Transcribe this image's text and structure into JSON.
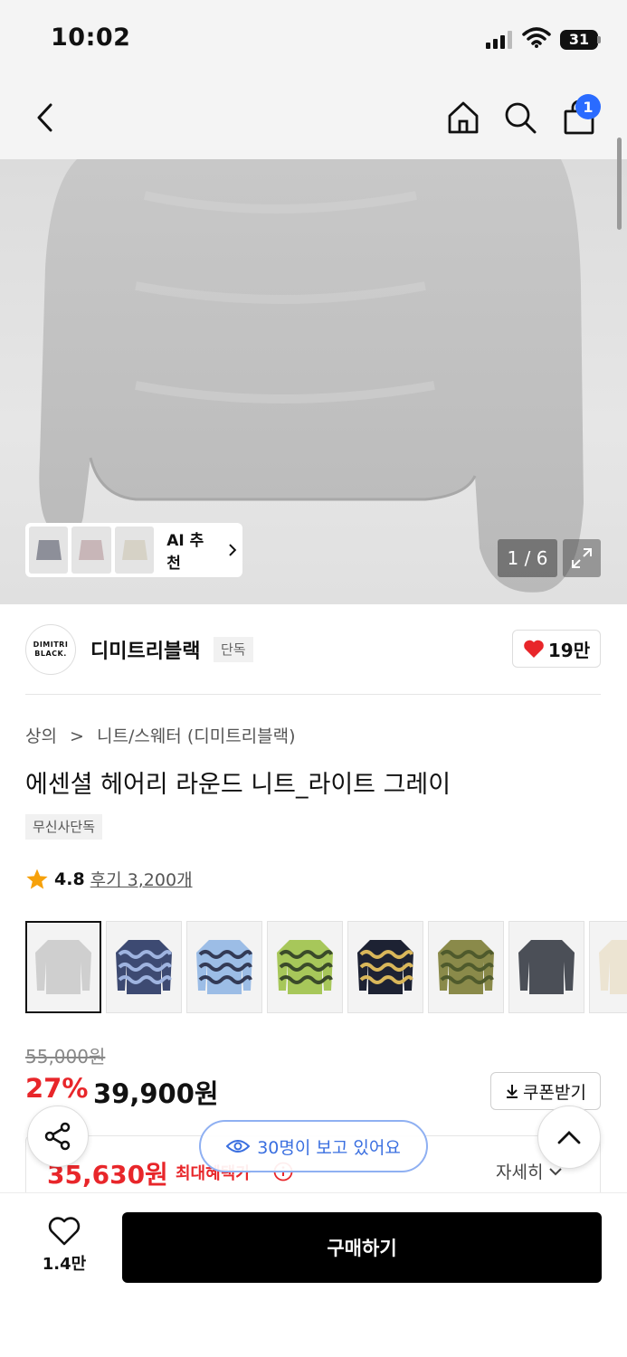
{
  "status": {
    "time": "10:02",
    "battery": "31"
  },
  "nav": {
    "back_icon": "chevron-left-icon",
    "home_icon": "home-icon",
    "search_icon": "search-icon",
    "cart_icon": "shopping-bag-icon",
    "cart_count": "1"
  },
  "gallery": {
    "ai_label": "AI 추천",
    "pager": "1 / 6",
    "expand_icon": "expand-icon"
  },
  "brand": {
    "logo_line1": "DIMITRI",
    "logo_line2": "BLACK.",
    "name": "디미트리블랙",
    "tag": "단독",
    "likes": "19만"
  },
  "product": {
    "breadcrumb_category": "상의",
    "breadcrumb_sub": "니트/스웨터 (디미트리블랙)",
    "title": "에센셜 헤어리 라운드 니트_라이트 그레이",
    "exclusive_tag": "무신사단독",
    "rating": "4.8",
    "reviews": "후기 3,200개"
  },
  "colors": [
    {
      "name": "light-gray",
      "base": "#cfcfcf",
      "stripe": ""
    },
    {
      "name": "navy-blue-wave",
      "base": "#3d4a72",
      "stripe": "#9fb4e0"
    },
    {
      "name": "sky-blue-wave",
      "base": "#9cbde6",
      "stripe": "#333a55"
    },
    {
      "name": "green-wave",
      "base": "#a7c75a",
      "stripe": "#3a4a2a"
    },
    {
      "name": "black-yellow-wave",
      "base": "#1d2233",
      "stripe": "#d9b75a"
    },
    {
      "name": "khaki-camo",
      "base": "#8a8a4a",
      "stripe": "#4f5a2c"
    },
    {
      "name": "charcoal",
      "base": "#4b4f57",
      "stripe": ""
    },
    {
      "name": "cream",
      "base": "#ece4d2",
      "stripe": ""
    }
  ],
  "price": {
    "original": "55,000원",
    "discount": "27%",
    "sale": "39,900원",
    "coupon_label": "쿠폰받기",
    "max_benefit_price": "35,630원",
    "max_benefit_label": "최대혜택가",
    "detail_label": "자세히"
  },
  "floating": {
    "viewers": "30명이 보고 있어요"
  },
  "bottom": {
    "wish_count": "1.4만",
    "buy_label": "구매하기"
  }
}
